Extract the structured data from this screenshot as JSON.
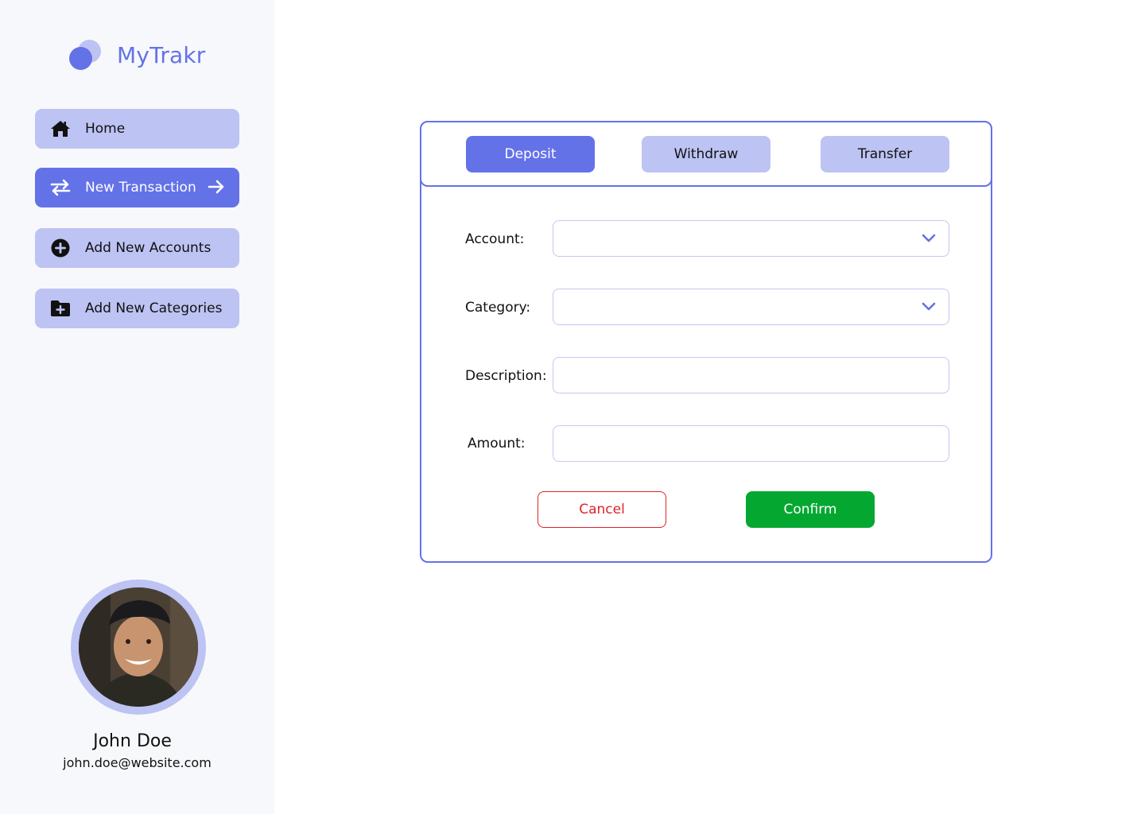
{
  "app": {
    "name": "MyTrakr"
  },
  "colors": {
    "accent": "#6472e8",
    "accent_light": "#bdc3f3",
    "confirm": "#04a830",
    "cancel": "#e0222b"
  },
  "sidebar": {
    "items": [
      {
        "label": "Home",
        "icon": "home-icon",
        "active": false
      },
      {
        "label": "New Transaction",
        "icon": "swap-arrows-icon",
        "active": true
      },
      {
        "label": "Add New Accounts",
        "icon": "plus-circle-icon",
        "active": false
      },
      {
        "label": "Add New Categories",
        "icon": "folder-plus-icon",
        "active": false
      }
    ]
  },
  "user": {
    "name": "John Doe",
    "email": "john.doe@website.com"
  },
  "transaction": {
    "tabs": [
      {
        "label": "Deposit",
        "active": true
      },
      {
        "label": "Withdraw",
        "active": false
      },
      {
        "label": "Transfer",
        "active": false
      }
    ],
    "fields": {
      "account": {
        "label": "Account:",
        "value": ""
      },
      "category": {
        "label": "Category:",
        "value": ""
      },
      "description": {
        "label": "Description:",
        "value": ""
      },
      "amount": {
        "label": "Amount:",
        "value": ""
      }
    },
    "cancel_label": "Cancel",
    "confirm_label": "Confirm"
  }
}
